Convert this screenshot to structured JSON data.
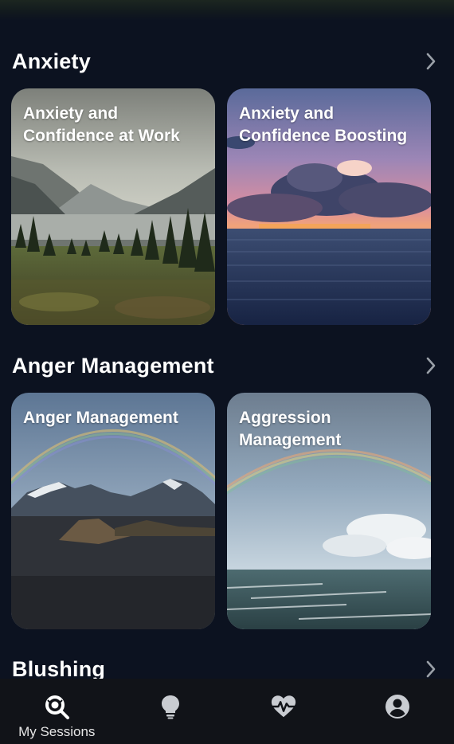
{
  "sections": [
    {
      "title": "Anxiety",
      "cards": [
        {
          "title": "Anxiety and Confidence at Work",
          "image": "mountain-lake-forest"
        },
        {
          "title": "Anxiety and Confidence Boosting",
          "image": "sunset-ocean-clouds"
        }
      ]
    },
    {
      "title": "Anger Management",
      "cards": [
        {
          "title": "Anger Management",
          "image": "rainbow-snowy-mountains"
        },
        {
          "title": "Aggression Management",
          "image": "rainbow-sea-waves"
        }
      ]
    },
    {
      "title": "Blushing",
      "cards": []
    }
  ],
  "bottom_nav": {
    "items": [
      {
        "label": "My Sessions",
        "icon": "search-sessions-icon",
        "active": true
      },
      {
        "label": "",
        "icon": "lightbulb-icon",
        "active": false
      },
      {
        "label": "",
        "icon": "heart-pulse-icon",
        "active": false
      },
      {
        "label": "",
        "icon": "account-icon",
        "active": false
      }
    ]
  },
  "colors": {
    "background": "#0c1220",
    "nav_background": "#111318",
    "text": "#ffffff"
  }
}
